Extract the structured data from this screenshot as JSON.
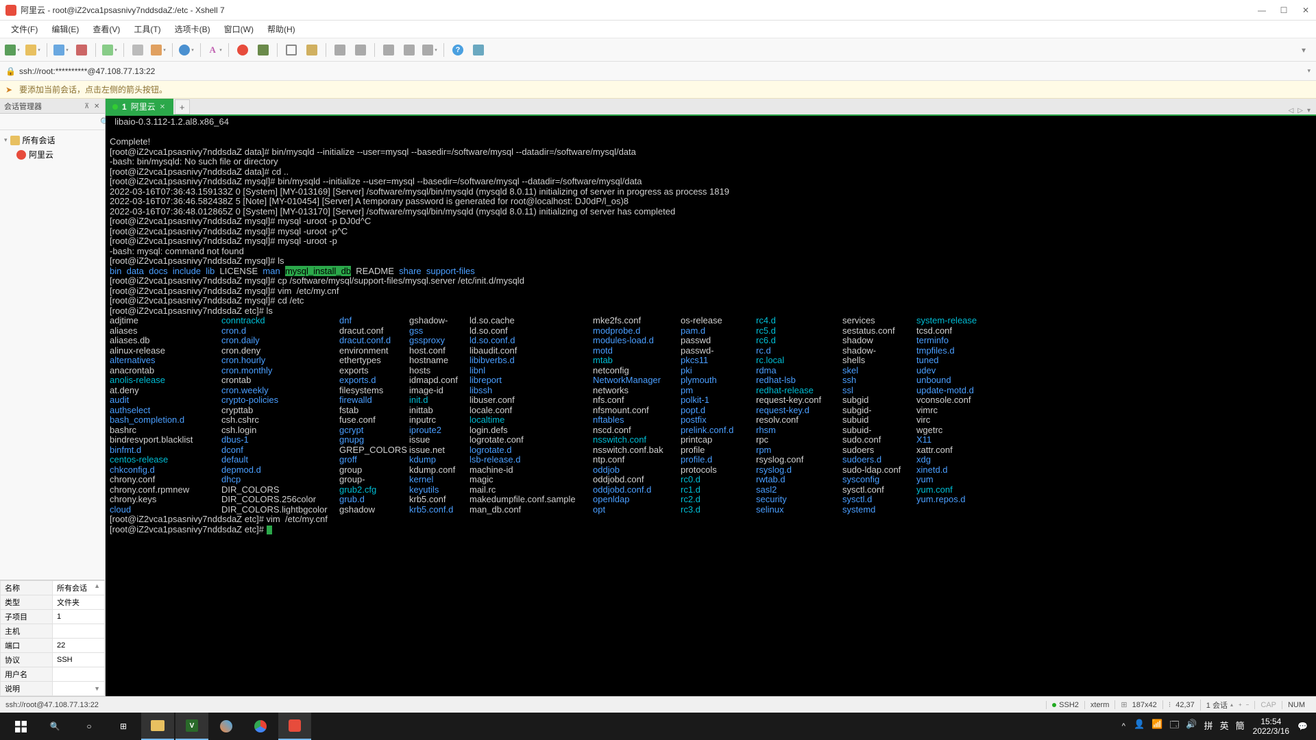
{
  "title": "阿里云 - root@iZ2vca1psasnivy7nddsdaZ:/etc - Xshell 7",
  "menu": [
    "文件(F)",
    "编辑(E)",
    "查看(V)",
    "工具(T)",
    "选项卡(B)",
    "窗口(W)",
    "帮助(H)"
  ],
  "addr": "ssh://root:**********@47.108.77.13:22",
  "hint": "要添加当前会话，点击左侧的箭头按钮。",
  "sidebar": {
    "title": "会话管理器",
    "root": "所有会话",
    "item": "阿里云",
    "props": [
      [
        "名称",
        "所有会话"
      ],
      [
        "类型",
        "文件夹"
      ],
      [
        "子项目",
        "1"
      ],
      [
        "主机",
        ""
      ],
      [
        "端口",
        "22"
      ],
      [
        "协议",
        "SSH"
      ],
      [
        "用户名",
        ""
      ],
      [
        "说明",
        ""
      ]
    ]
  },
  "tab": {
    "num": "1 ",
    "name": "阿里云"
  },
  "term": {
    "l1": "  libaio-0.3.112-1.2.al8.x86_64",
    "l2": "Complete!",
    "l3": "[root@iZ2vca1psasnivy7nddsdaZ data]# bin/mysqld --initialize --user=mysql --basedir=/software/mysql --datadir=/software/mysql/data",
    "l4": "-bash: bin/mysqld: No such file or directory",
    "l5": "[root@iZ2vca1psasnivy7nddsdaZ data]# cd ..",
    "l6": "[root@iZ2vca1psasnivy7nddsdaZ mysql]# bin/mysqld --initialize --user=mysql --basedir=/software/mysql --datadir=/software/mysql/data",
    "l7": "2022-03-16T07:36:43.159133Z 0 [System] [MY-013169] [Server] /software/mysql/bin/mysqld (mysqld 8.0.11) initializing of server in progress as process 1819",
    "l8": "2022-03-16T07:36:46.582438Z 5 [Note] [MY-010454] [Server] A temporary password is generated for root@localhost: DJ0dP/l_os)8",
    "l9": "2022-03-16T07:36:48.012865Z 0 [System] [MY-013170] [Server] /software/mysql/bin/mysqld (mysqld 8.0.11) initializing of server has completed",
    "l10": "[root@iZ2vca1psasnivy7nddsdaZ mysql]# mysql -uroot -p DJ0d^C",
    "l11": "[root@iZ2vca1psasnivy7nddsdaZ mysql]# mysql -uroot -p^C",
    "l12": "[root@iZ2vca1psasnivy7nddsdaZ mysql]# mysql -uroot -p",
    "l13": "-bash: mysql: command not found",
    "l14": "[root@iZ2vca1psasnivy7nddsdaZ mysql]# ls",
    "l15a": "bin",
    "l15b": "data",
    "l15c": "docs",
    "l15d": "include",
    "l15e": "lib",
    "l15f": "LICENSE",
    "l15g": "man",
    "l15h": "mysql_install_db",
    "l15i": "README",
    "l15j": "share",
    "l15k": "support-files",
    "l16": "[root@iZ2vca1psasnivy7nddsdaZ mysql]# cp /software/mysql/support-files/mysql.server /etc/init.d/mysqld",
    "l17": "[root@iZ2vca1psasnivy7nddsdaZ mysql]# vim  /etc/my.cnf",
    "l18": "[root@iZ2vca1psasnivy7nddsdaZ mysql]# cd /etc",
    "l19": "[root@iZ2vca1psasnivy7nddsdaZ etc]# ls",
    "l20": "[root@iZ2vca1psasnivy7nddsdaZ etc]# vim  /etc/my.cnf",
    "l21": "[root@iZ2vca1psasnivy7nddsdaZ etc]# "
  },
  "ls": [
    [
      "adjtime",
      "w"
    ],
    [
      "conntrackd",
      "cy"
    ],
    [
      "dnf",
      "bl"
    ],
    [
      "gshadow-",
      "w"
    ],
    [
      "ld.so.cache",
      "w"
    ],
    [
      "mke2fs.conf",
      "w"
    ],
    [
      "os-release",
      "w"
    ],
    [
      "rc4.d",
      "cy"
    ],
    [
      "services",
      "w"
    ],
    [
      "system-release",
      "cy"
    ],
    [
      "aliases",
      "w"
    ],
    [
      "cron.d",
      "bl"
    ],
    [
      "dracut.conf",
      "w"
    ],
    [
      "gss",
      "bl"
    ],
    [
      "ld.so.conf",
      "w"
    ],
    [
      "modprobe.d",
      "bl"
    ],
    [
      "pam.d",
      "bl"
    ],
    [
      "rc5.d",
      "cy"
    ],
    [
      "sestatus.conf",
      "w"
    ],
    [
      "tcsd.conf",
      "w"
    ],
    [
      "aliases.db",
      "w"
    ],
    [
      "cron.daily",
      "bl"
    ],
    [
      "dracut.conf.d",
      "bl"
    ],
    [
      "gssproxy",
      "bl"
    ],
    [
      "ld.so.conf.d",
      "bl"
    ],
    [
      "modules-load.d",
      "bl"
    ],
    [
      "passwd",
      "w"
    ],
    [
      "rc6.d",
      "cy"
    ],
    [
      "shadow",
      "w"
    ],
    [
      "terminfo",
      "bl"
    ],
    [
      "alinux-release",
      "w"
    ],
    [
      "cron.deny",
      "w"
    ],
    [
      "environment",
      "w"
    ],
    [
      "host.conf",
      "w"
    ],
    [
      "libaudit.conf",
      "w"
    ],
    [
      "motd",
      "bl"
    ],
    [
      "passwd-",
      "w"
    ],
    [
      "rc.d",
      "bl"
    ],
    [
      "shadow-",
      "w"
    ],
    [
      "tmpfiles.d",
      "bl"
    ],
    [
      "alternatives",
      "bl"
    ],
    [
      "cron.hourly",
      "bl"
    ],
    [
      "ethertypes",
      "w"
    ],
    [
      "hostname",
      "w"
    ],
    [
      "libibverbs.d",
      "bl"
    ],
    [
      "mtab",
      "cy"
    ],
    [
      "pkcs11",
      "bl"
    ],
    [
      "rc.local",
      "cy"
    ],
    [
      "shells",
      "w"
    ],
    [
      "tuned",
      "bl"
    ],
    [
      "anacrontab",
      "w"
    ],
    [
      "cron.monthly",
      "bl"
    ],
    [
      "exports",
      "w"
    ],
    [
      "hosts",
      "w"
    ],
    [
      "libnl",
      "bl"
    ],
    [
      "netconfig",
      "w"
    ],
    [
      "pki",
      "bl"
    ],
    [
      "rdma",
      "bl"
    ],
    [
      "skel",
      "bl"
    ],
    [
      "udev",
      "bl"
    ],
    [
      "anolis-release",
      "cy"
    ],
    [
      "crontab",
      "w"
    ],
    [
      "exports.d",
      "bl"
    ],
    [
      "idmapd.conf",
      "w"
    ],
    [
      "libreport",
      "bl"
    ],
    [
      "NetworkManager",
      "bl"
    ],
    [
      "plymouth",
      "bl"
    ],
    [
      "redhat-lsb",
      "bl"
    ],
    [
      "ssh",
      "bl"
    ],
    [
      "unbound",
      "bl"
    ],
    [
      "at.deny",
      "w"
    ],
    [
      "cron.weekly",
      "bl"
    ],
    [
      "filesystems",
      "w"
    ],
    [
      "image-id",
      "w"
    ],
    [
      "libssh",
      "bl"
    ],
    [
      "networks",
      "w"
    ],
    [
      "pm",
      "bl"
    ],
    [
      "redhat-release",
      "cy"
    ],
    [
      "ssl",
      "bl"
    ],
    [
      "update-motd.d",
      "bl"
    ],
    [
      "audit",
      "bl"
    ],
    [
      "crypto-policies",
      "bl"
    ],
    [
      "firewalld",
      "bl"
    ],
    [
      "init.d",
      "cy"
    ],
    [
      "libuser.conf",
      "w"
    ],
    [
      "nfs.conf",
      "w"
    ],
    [
      "polkit-1",
      "bl"
    ],
    [
      "request-key.conf",
      "w"
    ],
    [
      "subgid",
      "w"
    ],
    [
      "vconsole.conf",
      "w"
    ],
    [
      "authselect",
      "bl"
    ],
    [
      "crypttab",
      "w"
    ],
    [
      "fstab",
      "w"
    ],
    [
      "inittab",
      "w"
    ],
    [
      "locale.conf",
      "w"
    ],
    [
      "nfsmount.conf",
      "w"
    ],
    [
      "popt.d",
      "bl"
    ],
    [
      "request-key.d",
      "bl"
    ],
    [
      "subgid-",
      "w"
    ],
    [
      "vimrc",
      "w"
    ],
    [
      "bash_completion.d",
      "bl"
    ],
    [
      "csh.cshrc",
      "w"
    ],
    [
      "fuse.conf",
      "w"
    ],
    [
      "inputrc",
      "w"
    ],
    [
      "localtime",
      "cy"
    ],
    [
      "nftables",
      "bl"
    ],
    [
      "postfix",
      "bl"
    ],
    [
      "resolv.conf",
      "w"
    ],
    [
      "subuid",
      "w"
    ],
    [
      "virc",
      "w"
    ],
    [
      "bashrc",
      "w"
    ],
    [
      "csh.login",
      "w"
    ],
    [
      "gcrypt",
      "bl"
    ],
    [
      "iproute2",
      "bl"
    ],
    [
      "login.defs",
      "w"
    ],
    [
      "nscd.conf",
      "w"
    ],
    [
      "prelink.conf.d",
      "bl"
    ],
    [
      "rhsm",
      "bl"
    ],
    [
      "subuid-",
      "w"
    ],
    [
      "wgetrc",
      "w"
    ],
    [
      "bindresvport.blacklist",
      "w"
    ],
    [
      "dbus-1",
      "bl"
    ],
    [
      "gnupg",
      "bl"
    ],
    [
      "issue",
      "w"
    ],
    [
      "logrotate.conf",
      "w"
    ],
    [
      "nsswitch.conf",
      "cy"
    ],
    [
      "printcap",
      "w"
    ],
    [
      "rpc",
      "w"
    ],
    [
      "sudo.conf",
      "w"
    ],
    [
      "X11",
      "bl"
    ],
    [
      "binfmt.d",
      "bl"
    ],
    [
      "dconf",
      "bl"
    ],
    [
      "GREP_COLORS",
      "w"
    ],
    [
      "issue.net",
      "w"
    ],
    [
      "logrotate.d",
      "bl"
    ],
    [
      "nsswitch.conf.bak",
      "w"
    ],
    [
      "profile",
      "w"
    ],
    [
      "rpm",
      "bl"
    ],
    [
      "sudoers",
      "w"
    ],
    [
      "xattr.conf",
      "w"
    ],
    [
      "centos-release",
      "cy"
    ],
    [
      "default",
      "bl"
    ],
    [
      "groff",
      "bl"
    ],
    [
      "kdump",
      "bl"
    ],
    [
      "lsb-release.d",
      "bl"
    ],
    [
      "ntp.conf",
      "w"
    ],
    [
      "profile.d",
      "bl"
    ],
    [
      "rsyslog.conf",
      "w"
    ],
    [
      "sudoers.d",
      "bl"
    ],
    [
      "xdg",
      "bl"
    ],
    [
      "chkconfig.d",
      "bl"
    ],
    [
      "depmod.d",
      "bl"
    ],
    [
      "group",
      "w"
    ],
    [
      "kdump.conf",
      "w"
    ],
    [
      "machine-id",
      "w"
    ],
    [
      "oddjob",
      "bl"
    ],
    [
      "protocols",
      "w"
    ],
    [
      "rsyslog.d",
      "bl"
    ],
    [
      "sudo-ldap.conf",
      "w"
    ],
    [
      "xinetd.d",
      "bl"
    ],
    [
      "chrony.conf",
      "w"
    ],
    [
      "dhcp",
      "bl"
    ],
    [
      "group-",
      "w"
    ],
    [
      "kernel",
      "bl"
    ],
    [
      "magic",
      "w"
    ],
    [
      "oddjobd.conf",
      "w"
    ],
    [
      "rc0.d",
      "cy"
    ],
    [
      "rwtab.d",
      "bl"
    ],
    [
      "sysconfig",
      "bl"
    ],
    [
      "yum",
      "bl"
    ],
    [
      "chrony.conf.rpmnew",
      "w"
    ],
    [
      "DIR_COLORS",
      "w"
    ],
    [
      "grub2.cfg",
      "cy"
    ],
    [
      "keyutils",
      "bl"
    ],
    [
      "mail.rc",
      "w"
    ],
    [
      "oddjobd.conf.d",
      "bl"
    ],
    [
      "rc1.d",
      "cy"
    ],
    [
      "sasl2",
      "bl"
    ],
    [
      "sysctl.conf",
      "w"
    ],
    [
      "yum.conf",
      "cy"
    ],
    [
      "chrony.keys",
      "w"
    ],
    [
      "DIR_COLORS.256color",
      "w"
    ],
    [
      "grub.d",
      "bl"
    ],
    [
      "krb5.conf",
      "w"
    ],
    [
      "makedumpfile.conf.sample",
      "w"
    ],
    [
      "openldap",
      "bl"
    ],
    [
      "rc2.d",
      "cy"
    ],
    [
      "security",
      "bl"
    ],
    [
      "sysctl.d",
      "bl"
    ],
    [
      "yum.repos.d",
      "bl"
    ],
    [
      "cloud",
      "bl"
    ],
    [
      "DIR_COLORS.lightbgcolor",
      "w"
    ],
    [
      "gshadow",
      "w"
    ],
    [
      "krb5.conf.d",
      "bl"
    ],
    [
      "man_db.conf",
      "w"
    ],
    [
      "opt",
      "bl"
    ],
    [
      "rc3.d",
      "cy"
    ],
    [
      "selinux",
      "bl"
    ],
    [
      "systemd",
      "bl"
    ],
    [
      "",
      "w"
    ]
  ],
  "status": {
    "left": "ssh://root@47.108.77.13:22",
    "ssh": "SSH2",
    "term": "xterm",
    "size": "187x42",
    "pos": "42,37",
    "sess": "1 会话",
    "cap": "CAP",
    "num": "NUM"
  },
  "clock": {
    "time": "15:54",
    "date": "2022/3/16",
    "ime1": "拼",
    "ime2": "英",
    "ime3": "簡"
  }
}
